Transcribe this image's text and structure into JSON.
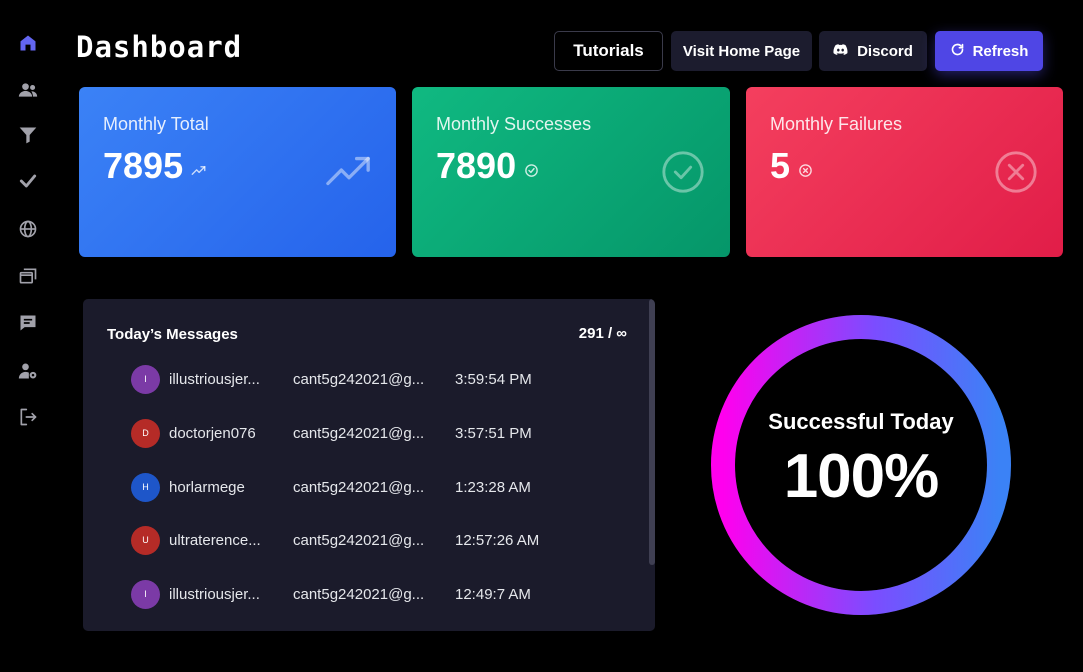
{
  "header": {
    "title": "Dashboard",
    "tutorials_label": "Tutorials",
    "home_label": "Visit Home Page",
    "discord_label": "Discord",
    "refresh_label": "Refresh"
  },
  "sidebar": {
    "items": [
      {
        "icon": "home-icon",
        "active": true
      },
      {
        "icon": "users-icon"
      },
      {
        "icon": "filter-icon"
      },
      {
        "icon": "check-icon"
      },
      {
        "icon": "globe-icon"
      },
      {
        "icon": "windows-icon"
      },
      {
        "icon": "message-icon"
      },
      {
        "icon": "user-settings-icon"
      },
      {
        "icon": "logout-icon"
      }
    ]
  },
  "cards": {
    "total": {
      "label": "Monthly Total",
      "value": "7895",
      "icon": "trending-up-icon"
    },
    "success": {
      "label": "Monthly Successes",
      "value": "7890",
      "icon": "check-circle-icon"
    },
    "fail": {
      "label": "Monthly Failures",
      "value": "5",
      "icon": "x-circle-icon"
    }
  },
  "messages": {
    "title": "Today’s Messages",
    "count": "291 / ∞",
    "rows": [
      {
        "initial": "I",
        "user": "illustriousjer...",
        "email": "cant5g242021@g...",
        "time": "3:59:54 PM",
        "color": "#7b3aa6"
      },
      {
        "initial": "D",
        "user": "doctorjen076",
        "email": "cant5g242021@g...",
        "time": "3:57:51 PM",
        "color": "#b52b27"
      },
      {
        "initial": "H",
        "user": "horlarmege",
        "email": "cant5g242021@g...",
        "time": "1:23:28 AM",
        "color": "#1e56c9"
      },
      {
        "initial": "U",
        "user": "ultraterence...",
        "email": "cant5g242021@g...",
        "time": "12:57:26 AM",
        "color": "#b52b27"
      },
      {
        "initial": "I",
        "user": "illustriousjer...",
        "email": "cant5g242021@g...",
        "time": "12:49:7 AM",
        "color": "#7b3aa6"
      }
    ]
  },
  "success_ring": {
    "label": "Successful Today",
    "value": "100%",
    "fraction": 1.0
  },
  "colors": {
    "accent": "#4f46e5",
    "active_icon": "#6366f1",
    "blue": "#3b82f6",
    "green": "#10b981",
    "red": "#f43f5e",
    "ring_start": "#ff00ee",
    "ring_end": "#3b82f6"
  }
}
